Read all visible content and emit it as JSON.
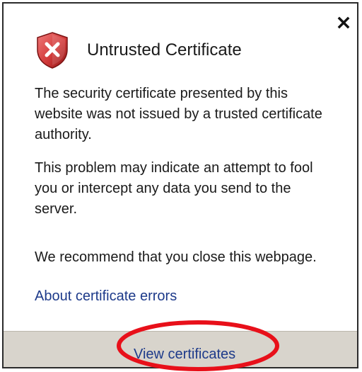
{
  "dialog": {
    "title": "Untrusted Certificate",
    "icon": "shield-error-icon",
    "close_icon": "close-icon",
    "paragraphs": [
      "The security certificate presented by this website was not issued by a trusted certificate authority.",
      "This problem may indicate an attempt to fool you or intercept any data you send to the server.",
      "We recommend that you close this webpage."
    ],
    "about_link": "About certificate errors",
    "footer_link": "View certificates"
  },
  "colors": {
    "shield_red": "#d23a3a",
    "link_blue": "#1d3a8a",
    "footer_bg": "#d8d4cc",
    "annotation_ring": "#e8101a"
  }
}
